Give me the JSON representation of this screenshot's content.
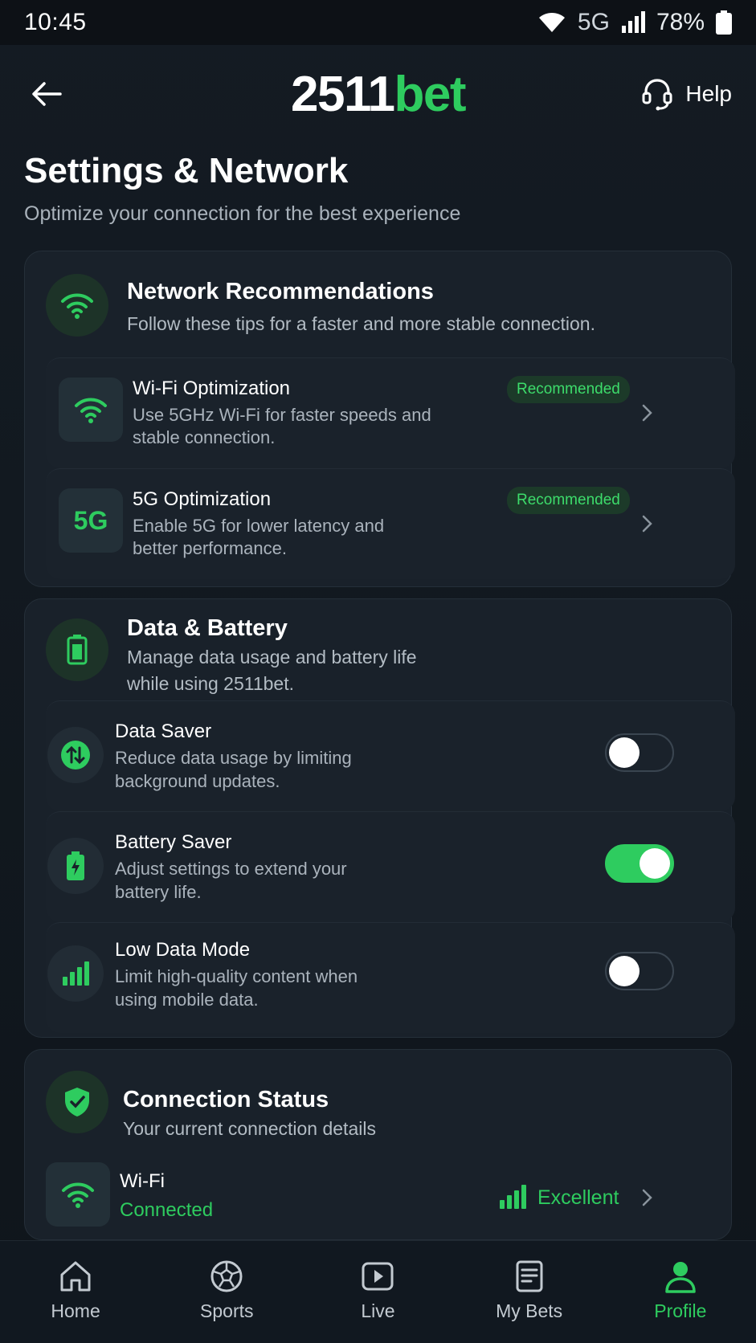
{
  "status_bar": {
    "time": "10:45",
    "network": "5G",
    "battery": "78%"
  },
  "header": {
    "logo_part1": "2511",
    "logo_part2": "bet",
    "help_label": "Help"
  },
  "page": {
    "title": "Settings & Network",
    "subtitle": "Optimize your connection for the best experience"
  },
  "network_card": {
    "title": "Network Recommendations",
    "desc": "Follow these tips for a faster and more stable connection.",
    "items": [
      {
        "title": "Wi-Fi Optimization",
        "desc_line1": "Use 5GHz Wi-Fi for faster speeds and",
        "desc_line2": "stable connection.",
        "badge": "Recommended"
      },
      {
        "title": "5G Optimization",
        "desc_line1": "Enable 5G for lower latency and",
        "desc_line2": "better performance.",
        "badge": "Recommended",
        "icon_text": "5G"
      }
    ]
  },
  "data_card": {
    "title": "Data & Battery",
    "desc_line1": "Manage data usage and battery life",
    "desc_line2": "while using 2511bet.",
    "items": [
      {
        "title": "Data Saver",
        "desc_line1": "Reduce data usage by limiting",
        "desc_line2": "background updates.",
        "enabled": false
      },
      {
        "title": "Battery Saver",
        "desc_line1": "Adjust settings to extend your",
        "desc_line2": "battery life.",
        "enabled": true
      },
      {
        "title": "Low Data Mode",
        "desc_line1": "Limit high-quality content when",
        "desc_line2": "using mobile data.",
        "enabled": false
      }
    ]
  },
  "connection_card": {
    "title": "Connection Status",
    "desc": "Your current connection details",
    "item": {
      "title": "Wi-Fi",
      "status": "Connected",
      "quality": "Excellent"
    }
  },
  "bottom_nav": {
    "items": [
      {
        "label": "Home"
      },
      {
        "label": "Sports"
      },
      {
        "label": "Live"
      },
      {
        "label": "My Bets"
      },
      {
        "label": "Profile"
      }
    ]
  },
  "colors": {
    "accent": "#2ecc5f",
    "background": "#111820",
    "card": "#19212a"
  }
}
